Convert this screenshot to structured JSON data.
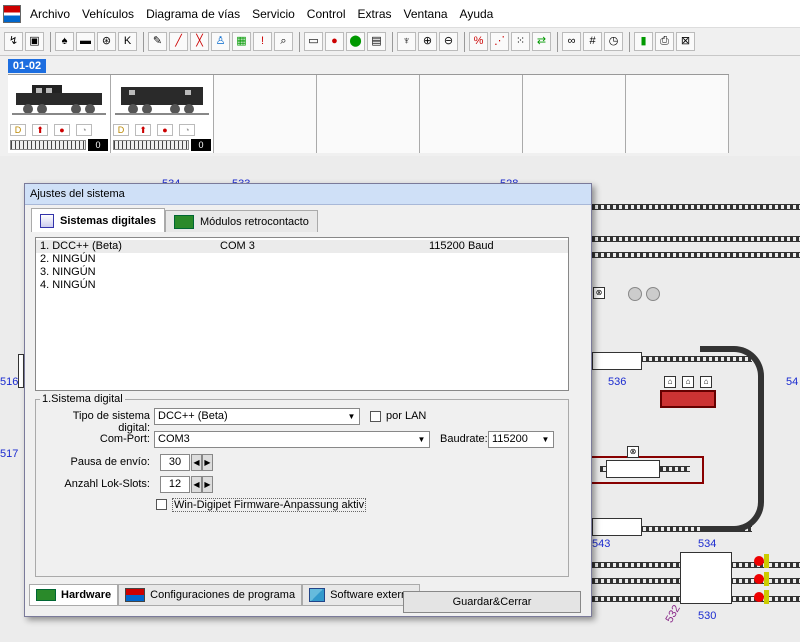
{
  "menu": [
    "Archivo",
    "Vehículos",
    "Diagrama de vías",
    "Servicio",
    "Control",
    "Extras",
    "Ventana",
    "Ayuda"
  ],
  "toolbar_icons": [
    "route-icon",
    "save-icon",
    "loco-icon",
    "train-icon",
    "turntable-icon",
    "kran-icon",
    "edit-icon",
    "signal-edit-icon",
    "cross-icon",
    "people-icon",
    "chip-icon",
    "warning-icon",
    "search-icon",
    "monitor-icon",
    "traffic-light-icon",
    "stop-icon",
    "db-icon",
    "antenna-icon",
    "zoom-in-icon",
    "zoom-out-icon",
    "blocks-icon",
    "grid-icon",
    "arrows-icon",
    "binoculars-icon",
    "numbers-icon",
    "clock-icon",
    "battery-icon",
    "print-icon",
    "close-window-icon"
  ],
  "loco_panel": {
    "tab_label": "01-02",
    "speed_1": "0",
    "speed_2": "0"
  },
  "layout": {
    "labels_top": [
      "534",
      "533",
      "528"
    ],
    "label_516": "516",
    "label_517": "517",
    "label_536": "536",
    "label_54": "54",
    "label_543": "543",
    "label_534b": "534",
    "label_530": "530",
    "label_532": "532"
  },
  "dialog": {
    "title": "Ajustes del sistema",
    "tabs": [
      "Sistemas digitales",
      "Módulos retrocontacto"
    ],
    "systems": [
      {
        "name": "1. DCC++ (Beta)",
        "port": "COM 3",
        "baud": "115200 Baud"
      },
      {
        "name": "2. NINGÚN",
        "port": "",
        "baud": ""
      },
      {
        "name": "3. NINGÚN",
        "port": "",
        "baud": ""
      },
      {
        "name": "4. NINGÚN",
        "port": "",
        "baud": ""
      }
    ],
    "group_title": "1.Sistema digital",
    "fields": {
      "tipo_label": "Tipo de sistema digital:",
      "tipo_value": "DCC++ (Beta)",
      "lan_label": "por LAN",
      "comport_label": "Com-Port:",
      "comport_value": "COM3",
      "baudrate_label": "Baudrate:",
      "baudrate_value": "115200",
      "pausa_label": "Pausa de envío:",
      "pausa_value": "30",
      "slots_label": "Anzahl Lok-Slots:",
      "slots_value": "12",
      "firmware_label": "Win-Digipet Firmware-Anpassung aktiv"
    },
    "bottom_tabs": [
      "Hardware",
      "Configuraciones de programa",
      "Software externo"
    ],
    "save_button": "Guardar&Cerrar"
  }
}
